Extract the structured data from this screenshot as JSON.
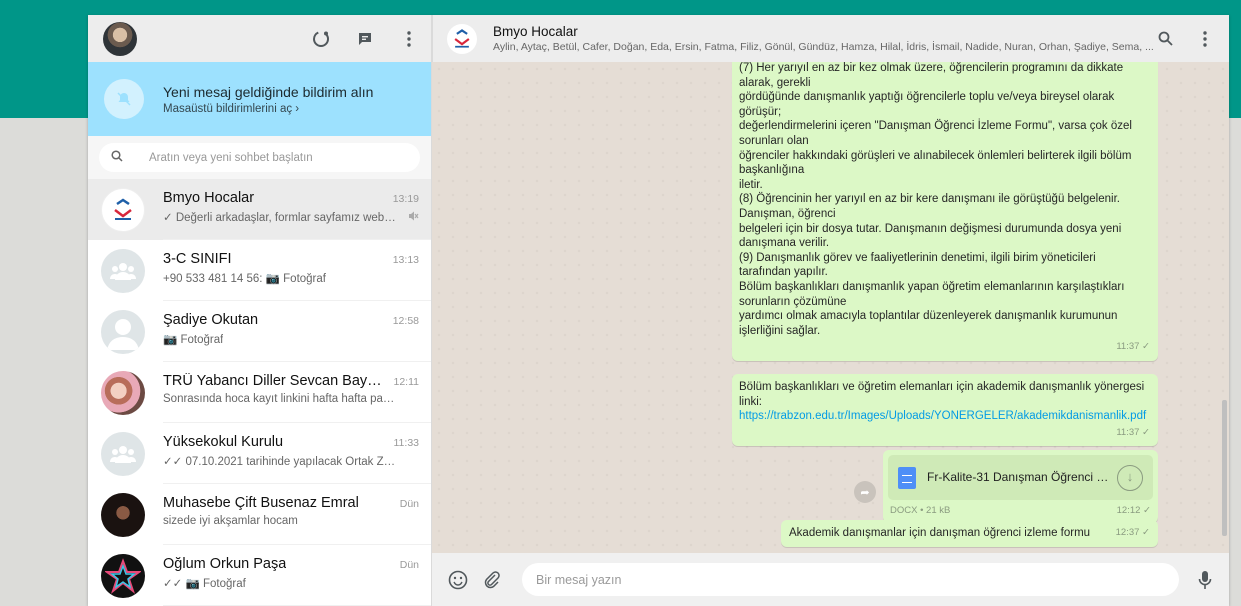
{
  "sidebar": {
    "notification": {
      "title": "Yeni mesaj geldiğinde bildirim alın",
      "subtitle": "Masaüstü bildirimlerini aç ›"
    },
    "search_placeholder": "Aratın veya yeni sohbet başlatın",
    "chats": [
      {
        "name": "Bmyo Hocalar",
        "time": "13:19",
        "preview": "✓ Değerli arkadaşlar, formlar sayfamız web sa...",
        "muted": true,
        "avatar": "logo"
      },
      {
        "name": "3-C SINIFI",
        "time": "13:13",
        "preview": "+90 533 481 14 56: 📷 Fotoğraf",
        "avatar": "group"
      },
      {
        "name": "Şadiye Okutan",
        "time": "12:58",
        "preview": "📷 Fotoğraf",
        "avatar": "user"
      },
      {
        "name": "TRÜ Yabancı Diller Sevcan Bayrakta...",
        "time": "12:11",
        "preview": "Sonrasında hoca kayıt  linkini hafta hafta paylaşa...",
        "avatar": "photo-pink"
      },
      {
        "name": "Yüksekokul Kurulu",
        "time": "11:33",
        "preview": "✓✓ 07.10.2021 tarihinde yapılacak Ortak Zorunlu ...",
        "avatar": "group"
      },
      {
        "name": "Muhasebe Çift Busenaz Emral",
        "time": "Dün",
        "preview": "sizede iyi akşamlar hocam",
        "avatar": "photo-dark"
      },
      {
        "name": "Oğlum Orkun Paşa",
        "time": "Dün",
        "preview": "✓✓ 📷 Fotoğraf",
        "avatar": "photo-star"
      }
    ]
  },
  "conversation": {
    "title": "Bmyo Hocalar",
    "members": "Aylin, Aytaç, Betül, Cafer, Doğan, Eda, Ersin, Fatma, Filiz, Gönül, Gündüz, Hamza, Hilal, İdris, İsmail, Nadide, Nuran, Orhan, Şadiye, Sema, ...",
    "messages": [
      {
        "text": "(7) Her yarıyıl en az bir kez olmak üzere, öğrencilerin programını da dikkate alarak, gerekli\ngördüğünde danışmanlık yaptığı öğrencilerle toplu ve/veya bireysel olarak görüşür;\ndeğerlendirmelerini içeren \"Danışman Öğrenci İzleme Formu\", varsa çok özel sorunları olan\nöğrenciler hakkındaki görüşleri ve alınabilecek önlemleri belirterek ilgili bölüm başkanlığına\niletir.\n(8) Öğrencinin her yarıyıl en az bir kere danışmanı ile görüştüğü belgelenir. Danışman, öğrenci\nbelgeleri için bir dosya tutar. Danışmanın değişmesi durumunda dosya yeni danışmana verilir.\n(9) Danışmanlık görev ve faaliyetlerinin denetimi, ilgili birim yöneticileri tarafından yapılır.\nBölüm başkanlıkları danışmanlık yapan öğretim elemanlarının karşılaştıkları sorunların çözümüne\nyardımcı olmak amacıyla toplantılar düzenleyerek danışmanlık kurumunun işlerliğini sağlar.",
        "time": "11:37 ✓"
      },
      {
        "text": "Bölüm başkanlıkları ve öğretim elemanları için akademik danışmanlık yönergesi linki:",
        "link": "https://trabzon.edu.tr/Images/Uploads/YONERGELER/akademikdanismanlik.pdf",
        "time": "11:37 ✓"
      },
      {
        "doc_name": "Fr-Kalite-31 Danışman Öğrenci İ...",
        "doc_meta": "DOCX • 21 kB",
        "time": "12:12 ✓"
      },
      {
        "text": "Akademik danışmanlar için danışman öğrenci izleme formu",
        "time": "12:37 ✓"
      }
    ]
  },
  "composer": {
    "placeholder": "Bir mesaj yazın"
  }
}
